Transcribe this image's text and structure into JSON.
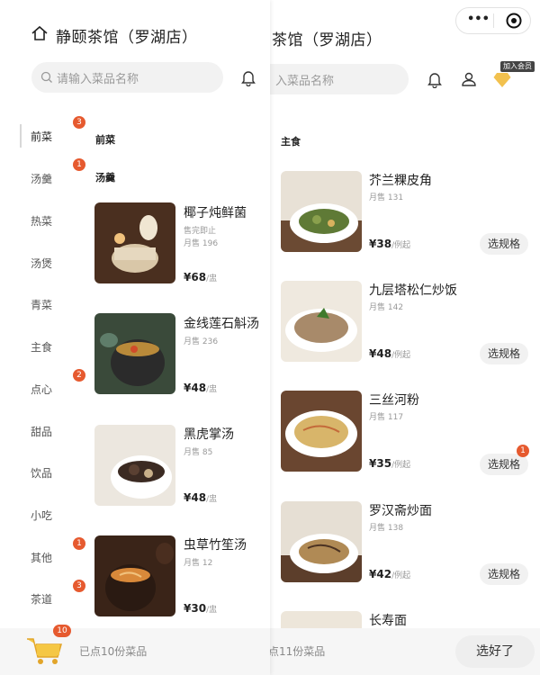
{
  "left": {
    "title": "静颐茶馆（罗湖店）",
    "search_placeholder": "请输入菜品名称",
    "categories": [
      "前菜",
      "汤羹",
      "热菜",
      "汤煲",
      "青菜",
      "主食",
      "点心",
      "甜品",
      "饮品",
      "小吃",
      "其他",
      "茶道"
    ],
    "category_badges": {
      "c0": "3",
      "c1": "1",
      "c6": "2",
      "c10": "1",
      "c11": "3"
    },
    "section_qianca": "前菜",
    "section_tanggeng": "汤羹",
    "dishes": [
      {
        "name": "椰子炖鲜菌",
        "status": "售完即止",
        "sales": "月售 196",
        "price": "¥68",
        "unit": "/盅"
      },
      {
        "name": "金线莲石斛汤",
        "sales": "月售 236",
        "price": "¥48",
        "unit": "/盅"
      },
      {
        "name": "黑虎掌汤",
        "sales": "月售 85",
        "price": "¥48",
        "unit": "/盅"
      },
      {
        "name": "虫草竹笙汤",
        "sales": "月售 12",
        "price": "¥30",
        "unit": "/盅"
      }
    ],
    "cart_badge": "10",
    "cart_text": "已点10份菜品"
  },
  "right": {
    "title": "茶馆（罗湖店）",
    "search_placeholder": "入菜品名称",
    "vip_label": "加入会员",
    "section": "主食",
    "dishes": [
      {
        "name": "芥兰粿皮角",
        "sales": "月售 131",
        "price": "¥38",
        "unit": "/例起",
        "button": "选规格"
      },
      {
        "name": "九层塔松仁炒饭",
        "sales": "月售 142",
        "price": "¥48",
        "unit": "/例起",
        "button": "选规格"
      },
      {
        "name": "三丝河粉",
        "sales": "月售 117",
        "price": "¥35",
        "unit": "/例起",
        "button": "选规格",
        "badge": "1"
      },
      {
        "name": "罗汉斋炒面",
        "sales": "月售 138",
        "price": "¥42",
        "unit": "/例起",
        "button": "选规格"
      },
      {
        "name": "长寿面"
      }
    ],
    "cart_text": "点11份菜品",
    "done_button": "选好了",
    "capsule_more": "•••"
  },
  "colors": {
    "accent_badge": "#e65a2f",
    "vip_gold": "#f2c14e"
  }
}
